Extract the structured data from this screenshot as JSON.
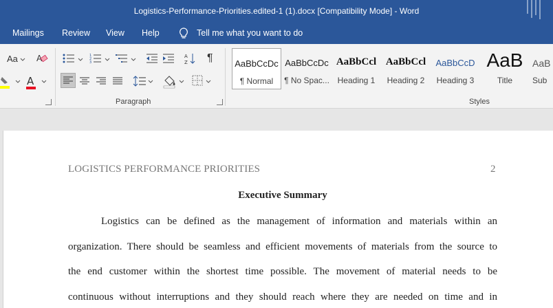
{
  "window": {
    "title": "Logistics-Performance-Priorities.edited-1 (1).docx [Compatibility Mode]  -  Word"
  },
  "menu": {
    "tabs": [
      "Mailings",
      "Review",
      "View",
      "Help"
    ],
    "tell_me": "Tell me what you want to do"
  },
  "ribbon": {
    "font": {
      "change_case": "Aa"
    },
    "paragraph_label": "Paragraph",
    "styles_label": "Styles",
    "styles": [
      {
        "sample": "AaBbCcDc",
        "name": "¶ Normal"
      },
      {
        "sample": "AaBbCcDc",
        "name": "¶ No Spac..."
      },
      {
        "sample": "AaBbCcl",
        "name": "Heading 1"
      },
      {
        "sample": "AaBbCcl",
        "name": "Heading 2"
      },
      {
        "sample": "AaBbCcD",
        "name": "Heading 3"
      },
      {
        "sample": "AaB",
        "name": "Title"
      },
      {
        "sample": "AaB",
        "name": "Sub"
      }
    ],
    "colors": {
      "highlight": "#ffff00",
      "font_color": "#e81123",
      "accent": "#2b579a"
    }
  },
  "document": {
    "header": "LOGISTICS PERFORMANCE PRIORITIES",
    "page_number": "2",
    "heading": "Executive Summary",
    "lines": [
      "Logistics can be defined as the management of information and materials within an",
      "organization. There should be seamless and efficient movements of materials from the source to",
      "the end customer within the shortest time possible. The movement of material needs to be",
      "continuous without interruptions and they should reach where they are needed on time and in"
    ]
  }
}
